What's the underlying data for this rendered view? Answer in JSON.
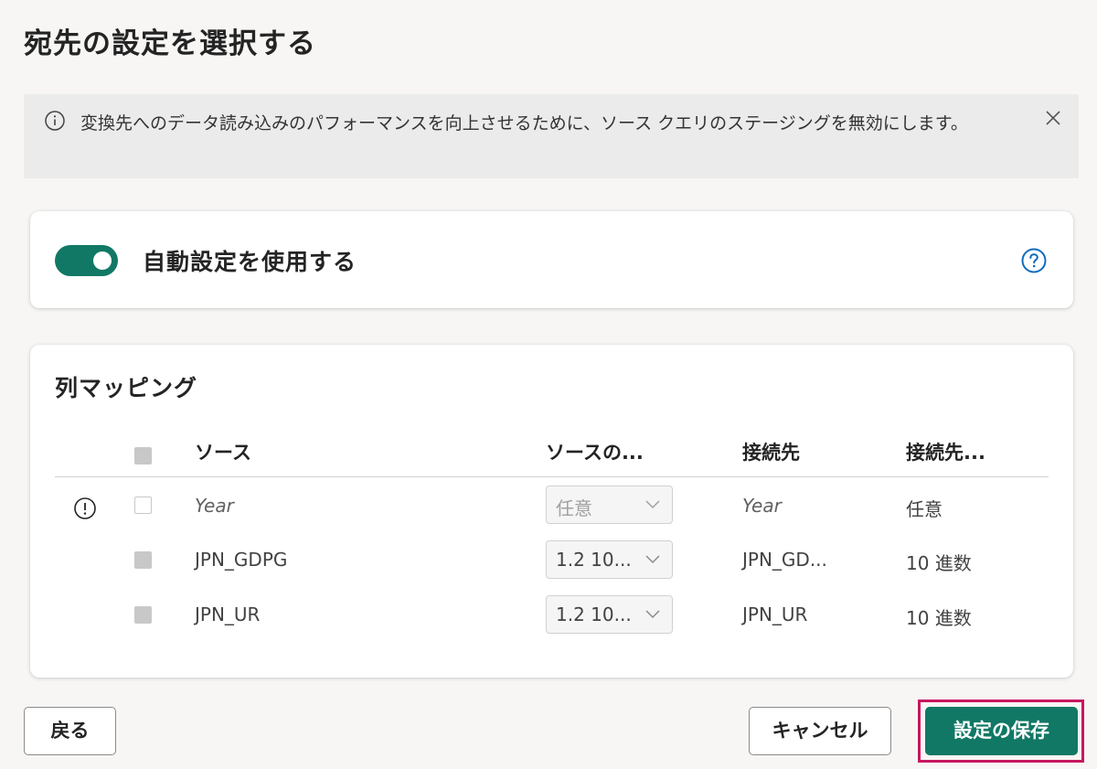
{
  "page": {
    "title": "宛先の設定を選択する"
  },
  "banner": {
    "message": "変換先へのデータ読み込みのパフォーマンスを向上させるために、ソース クエリのステージングを無効にします。",
    "info_icon": "info-icon",
    "close_icon": "close-icon"
  },
  "auto_settings": {
    "label": "自動設定を使用する",
    "toggle_on": true,
    "help_icon": "help-question-icon"
  },
  "mapping": {
    "title": "列マッピング",
    "headers": {
      "source": "ソース",
      "source_type": "ソースの...",
      "destination": "接続先",
      "destination_type": "接続先..."
    },
    "rows": [
      {
        "warning": true,
        "checked": false,
        "source": "Year",
        "source_type": "任意",
        "source_type_disabled": true,
        "destination": "Year",
        "destination_type": "任意",
        "italic": true
      },
      {
        "warning": false,
        "checked": true,
        "source": "JPN_GDPG",
        "source_type": "1.2  10...",
        "source_type_disabled": false,
        "destination": "JPN_GD...",
        "destination_type": "10 進数",
        "italic": false
      },
      {
        "warning": false,
        "checked": true,
        "source": "JPN_UR",
        "source_type": "1.2  10...",
        "source_type_disabled": false,
        "destination": "JPN_UR",
        "destination_type": "10 進数",
        "italic": false
      }
    ]
  },
  "footer": {
    "back_label": "戻る",
    "cancel_label": "キャンセル",
    "save_label": "設定の保存"
  },
  "colors": {
    "accent": "#117865",
    "highlight_frame": "#c8175f",
    "help_icon": "#0f6cbd"
  }
}
